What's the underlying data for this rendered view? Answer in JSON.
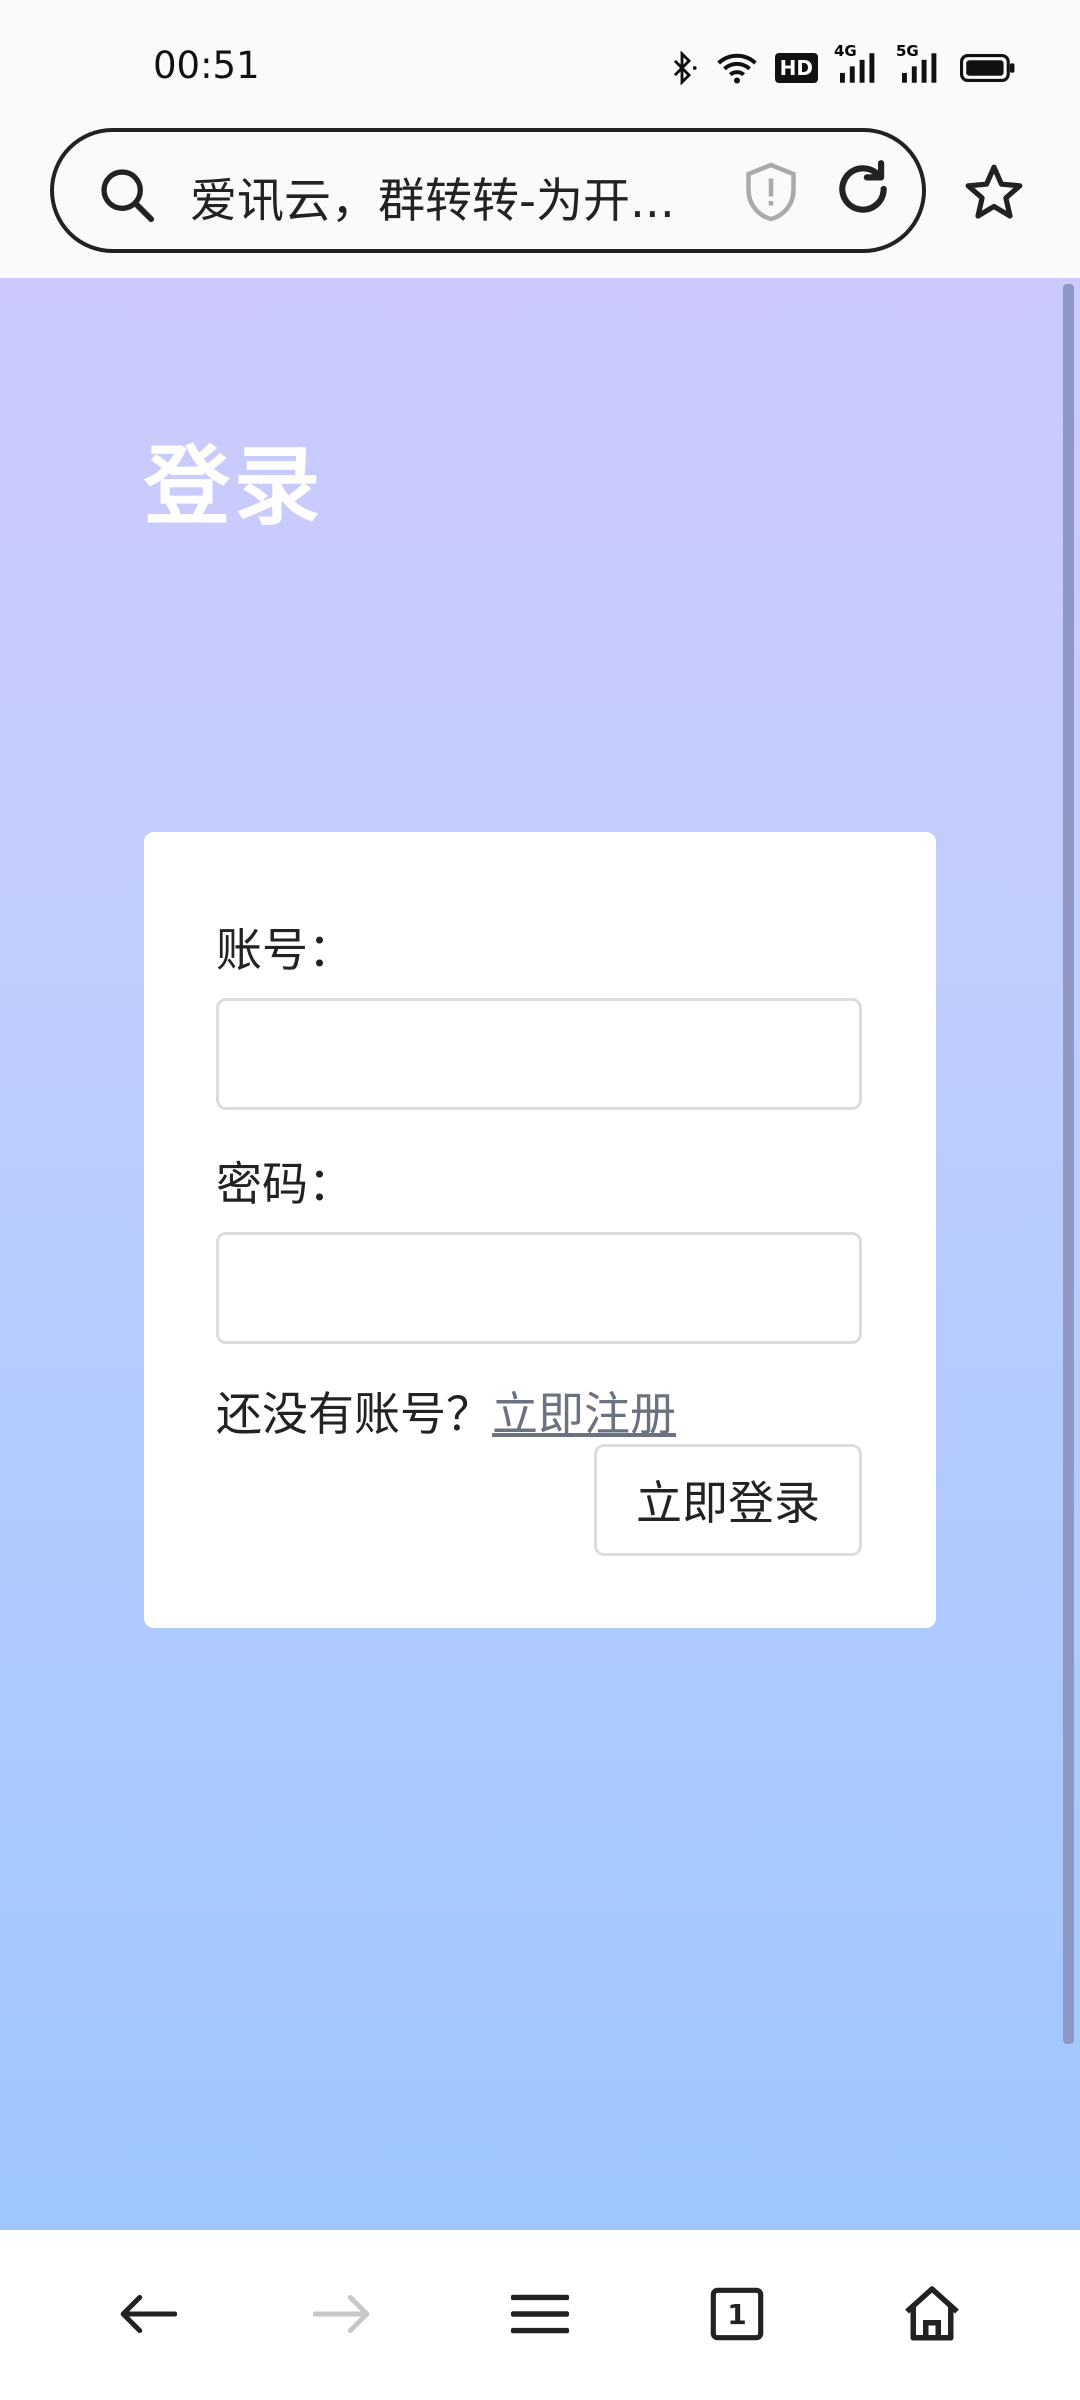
{
  "status_bar": {
    "time": "00:51",
    "icons": [
      "bluetooth-icon",
      "wifi-icon",
      "hd-icon",
      "signal-4g-icon",
      "signal-5g-icon",
      "battery-icon"
    ],
    "hd_label": "HD",
    "net_4g": "4G",
    "net_5g": "5G"
  },
  "browser": {
    "url_text": "爱讯云，群转转-为开...",
    "icons": [
      "search-icon",
      "shield-icon",
      "reload-icon",
      "star-icon"
    ]
  },
  "page": {
    "title": "登录",
    "account_label": "账号：",
    "account_value": "",
    "password_label": "密码：",
    "password_value": "",
    "register_prompt": "还没有账号？",
    "register_link": "立即注册",
    "login_button": "立即登录",
    "colors": {
      "gradient_top": "#cccafc",
      "gradient_bottom": "#9dc7fd"
    }
  },
  "bottom_nav": {
    "tab_count": "1",
    "icons": [
      "back-icon",
      "forward-icon",
      "menu-icon",
      "tabs-icon",
      "home-icon"
    ]
  }
}
